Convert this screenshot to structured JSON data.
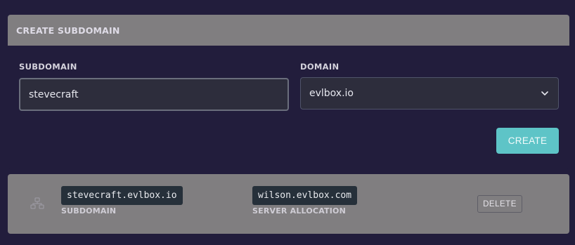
{
  "create_panel": {
    "title": "CREATE SUBDOMAIN",
    "subdomain_label": "SUBDOMAIN",
    "subdomain_value": "stevecraft",
    "domain_label": "DOMAIN",
    "domain_selected": "evlbox.io",
    "create_button_label": "CREATE"
  },
  "subdomains": [
    {
      "subdomain": "stevecraft.evlbox.io",
      "subdomain_caption": "SUBDOMAIN",
      "allocation": "wilson.evlbox.com",
      "allocation_caption": "SERVER ALLOCATION",
      "delete_label": "DELETE",
      "icon": "network-icon"
    }
  ],
  "colors": {
    "background": "#221d3c",
    "panel_header": "#807e80",
    "accent": "#5ec4c7",
    "input_bg": "#2d2d3c"
  }
}
